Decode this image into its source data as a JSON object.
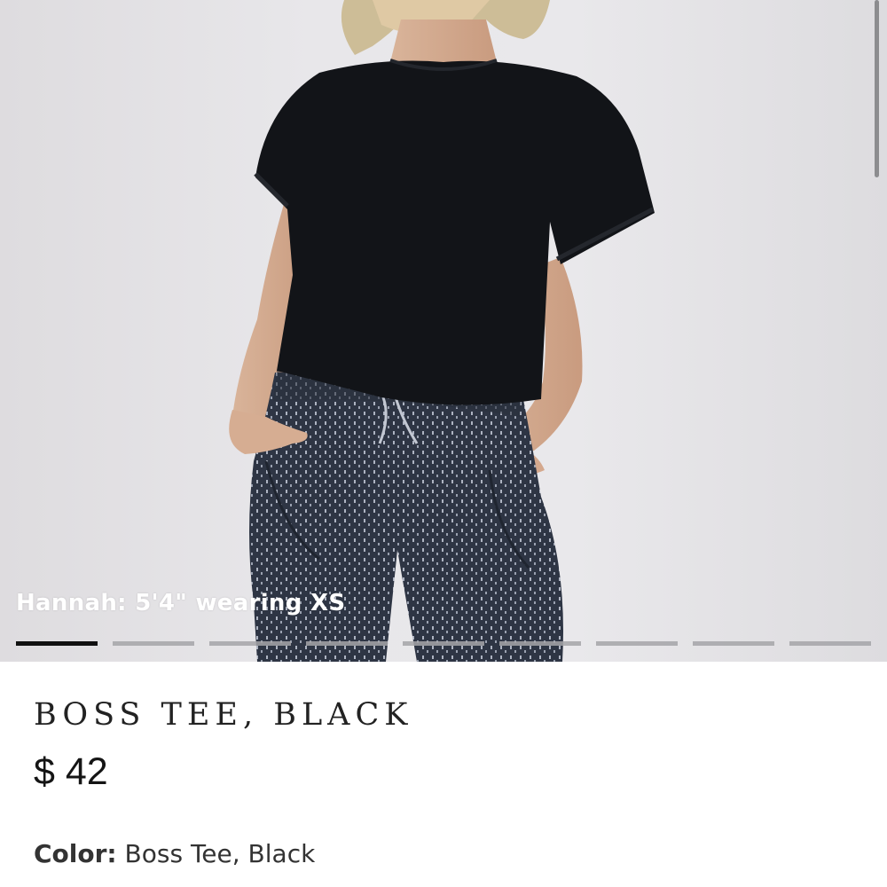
{
  "gallery": {
    "model_caption": "Hannah: 5'4\" wearing XS",
    "slide_count": 9,
    "active_slide": 1
  },
  "product": {
    "title": "BOSS TEE, BLACK",
    "price": "$ 42",
    "color_label": "Color:",
    "color_value": "Boss Tee, Black"
  },
  "colors": {
    "background": "#ffffff",
    "title_text": "#222222",
    "active_indicator": "#111111",
    "inactive_indicator": "#a5a5a8"
  }
}
